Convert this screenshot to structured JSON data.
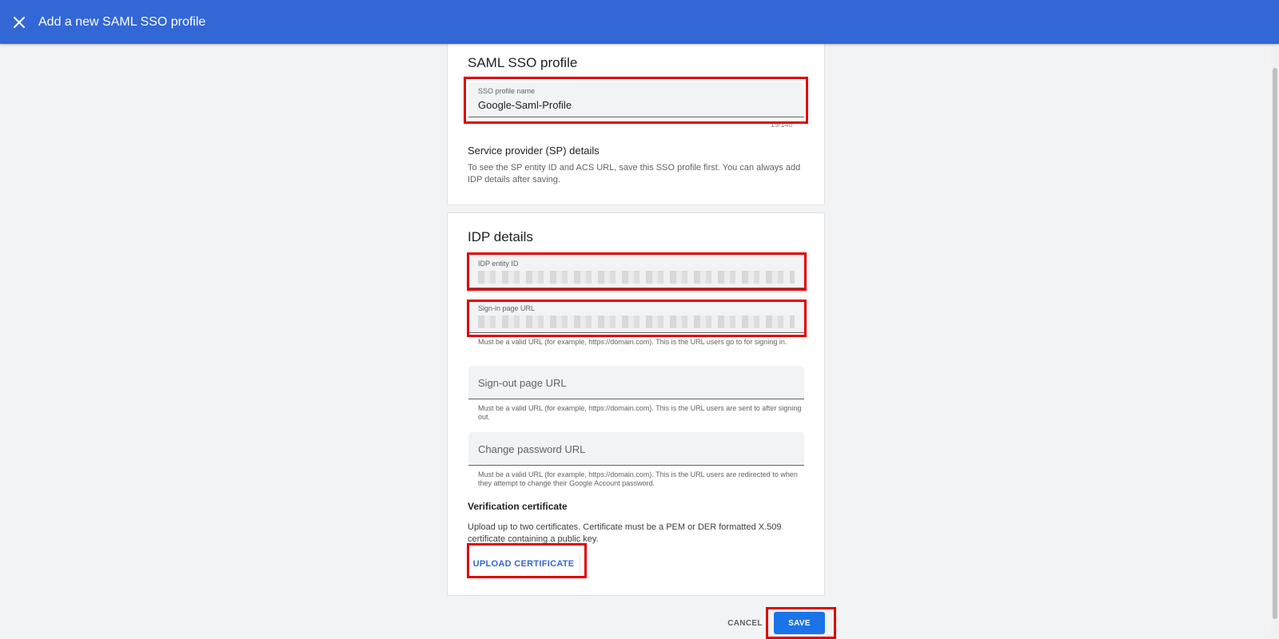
{
  "header": {
    "title": "Add a new SAML SSO profile",
    "close_icon": "close-icon"
  },
  "profile_card": {
    "title": "SAML SSO profile",
    "name_field": {
      "label": "SSO profile name",
      "value": "Google-Saml-Profile",
      "counter": "19/140"
    },
    "sp_title": "Service provider (SP) details",
    "sp_description": "To see the SP entity ID and ACS URL, save this SSO profile first. You can always add IDP details after saving."
  },
  "idp_card": {
    "title": "IDP details",
    "entity_id": {
      "label": "IDP entity ID"
    },
    "sign_in": {
      "label": "Sign-in page URL",
      "helper": "Must be a valid URL (for example, https://domain.com). This is the URL users go to for signing in."
    },
    "sign_out": {
      "placeholder": "Sign-out page URL",
      "helper": "Must be a valid URL (for example, https://domain.com). This is the URL users are sent to after signing out."
    },
    "change_password": {
      "placeholder": "Change password URL",
      "helper": "Must be a valid URL (for example, https://domain.com). This is the URL users are redirected to when they attempt to change their Google Account password."
    },
    "cert_title": "Verification certificate",
    "cert_description": "Upload up to two certificates. Certificate must be a PEM or DER formatted X.509 certificate containing a public key.",
    "upload_label": "UPLOAD CERTIFICATE"
  },
  "footer": {
    "cancel_label": "CANCEL",
    "save_label": "SAVE"
  },
  "colors": {
    "header": "#3367d6",
    "primary": "#1a73e8",
    "highlight": "#e00000"
  }
}
